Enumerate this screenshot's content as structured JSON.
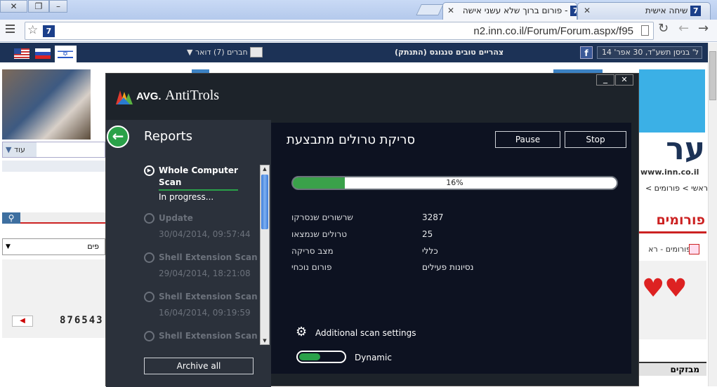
{
  "browser": {
    "tabs": [
      {
        "title": "שיחה אישית",
        "icon": "7"
      },
      {
        "title": "פורום ברוך שלא עשני אישה -",
        "icon": "7"
      }
    ],
    "url": "n2.inn.co.il/Forum/Forum.aspx/f95",
    "logo_text": "7"
  },
  "site": {
    "date": "ל' בניסן תשע\"ד, 30 אפר' 14",
    "top_link": "צהריים טובים טנגוגס (התנתק)",
    "friends": "חברים (7)",
    "mail": "דואר",
    "more_label": "עוד",
    "brand_text": "ער",
    "brand_url": "www.inn.co.il",
    "breadcrumb": "ראשי > פורומים >",
    "forums_title": "פורומים",
    "forums_sub": "פורומים - רא",
    "select_text": "פים",
    "counter": "876543",
    "bottom_label": "מבזקים",
    "colors": {
      "nav": "#1c3256",
      "accent": "#cc2222",
      "link": "#1a63a6"
    }
  },
  "avg": {
    "logo": "AVG.",
    "product": "AntiTrols",
    "reports_title": "Reports",
    "items": [
      {
        "title": "Whole Computer Scan",
        "status": "In progress...",
        "active": true
      },
      {
        "title": "Update",
        "date": "30/04/2014, 09:57:44"
      },
      {
        "title": "Shell Extension Scan",
        "date": "29/04/2014, 18:21:08"
      },
      {
        "title": "Shell Extension Scan",
        "date": "16/04/2014, 09:19:59"
      },
      {
        "title": "Shell Extension Scan",
        "date": ""
      }
    ],
    "archive_label": "Archive all",
    "scan_title": "סריקת טרולים מתבצעת",
    "pause_label": "Pause",
    "stop_label": "Stop",
    "progress": 16,
    "progress_text": "16%",
    "stats": [
      {
        "label": "שרשורים שנסרקו",
        "value": "3287"
      },
      {
        "label": "טרולים שנמצאו",
        "value": "25"
      },
      {
        "label": "מצב סריקה",
        "value": "כללי"
      },
      {
        "label": "פורום נוכחי",
        "value": "נסיונות פעילים"
      }
    ],
    "additional_settings": "Additional scan settings",
    "dynamic_label": "Dynamic",
    "colors": {
      "progress": "#3aa14a",
      "accent_green": "#2aa149",
      "bg": "#0d1221"
    }
  }
}
